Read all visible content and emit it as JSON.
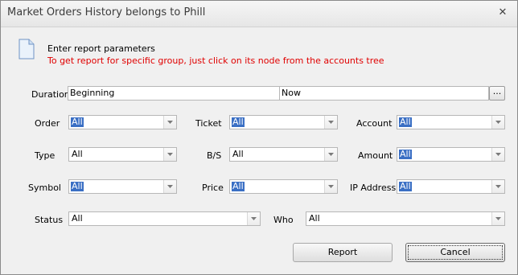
{
  "window": {
    "title": "Market Orders History belongs to Phill",
    "close_glyph": "✕"
  },
  "header": {
    "line1": "Enter report parameters",
    "line2": "To get report for specific group, just click on its node from the accounts tree",
    "warning_color": "#e00000"
  },
  "duration": {
    "label": "Duration",
    "from": "Beginning",
    "to": "Now",
    "picker_label": "..."
  },
  "fields": {
    "order": {
      "label": "Order",
      "value": "All"
    },
    "ticket": {
      "label": "Ticket",
      "value": "All"
    },
    "account": {
      "label": "Account",
      "value": "All"
    },
    "type": {
      "label": "Type",
      "value": "All"
    },
    "bs": {
      "label": "B/S",
      "value": "All"
    },
    "amount": {
      "label": "Amount",
      "value": "All"
    },
    "symbol": {
      "label": "Symbol",
      "value": "All"
    },
    "price": {
      "label": "Price",
      "value": "All"
    },
    "ip": {
      "label": "IP Address",
      "value": "All"
    },
    "status": {
      "label": "Status",
      "value": "All"
    },
    "who": {
      "label": "Who",
      "value": "All"
    }
  },
  "buttons": {
    "report": "Report",
    "cancel": "Cancel"
  },
  "icons": {
    "document": "document-icon",
    "dropdown": "chevron-down-icon",
    "close": "close-icon"
  },
  "colors": {
    "selection": "#3a6fc4"
  }
}
